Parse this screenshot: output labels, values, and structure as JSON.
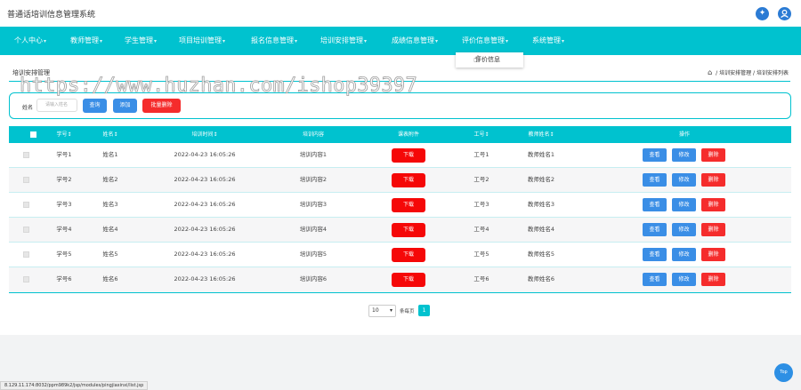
{
  "app": {
    "title": "普通话培训信息管理系统",
    "header_icons": [
      "settings-icon",
      "user-icon"
    ]
  },
  "nav": {
    "items": [
      {
        "label": "个人中心"
      },
      {
        "label": "教师管理"
      },
      {
        "label": "学生管理"
      },
      {
        "label": "项目培训管理"
      },
      {
        "label": "报名信息管理"
      },
      {
        "label": "培训安排管理"
      },
      {
        "label": "成绩信息管理"
      },
      {
        "label": "评价信息管理"
      },
      {
        "label": "系统管理"
      }
    ],
    "open_menu": {
      "parent": "评价信息管理",
      "items": [
        "评价信息"
      ]
    }
  },
  "page": {
    "title": "培训安排管理",
    "breadcrumb": [
      "home-icon",
      "培训安排管理",
      "培训安排列表"
    ],
    "breadcrumb_sep": "/",
    "watermark": "https://www.huzhan.com/ishop39397"
  },
  "search": {
    "label": "姓名",
    "placeholder": "请输入姓名",
    "query_label": "查询",
    "add_label": "添加",
    "batch_delete_label": "批量删除"
  },
  "table": {
    "columns": [
      "学号",
      "姓名",
      "培训时间",
      "培训内容",
      "课表附件",
      "工号",
      "教师姓名",
      "操作"
    ],
    "sortable": [
      true,
      true,
      true,
      false,
      false,
      true,
      true,
      false
    ],
    "download_label": "下载",
    "actions": {
      "view": "查看",
      "edit": "修改",
      "delete": "删除"
    },
    "rows": [
      {
        "xuehao": "学号1",
        "xingming": "姓名1",
        "time": "2022-04-23 16:05:26",
        "content": "培训内容1",
        "gonghao": "工号1",
        "teacher": "教师姓名1"
      },
      {
        "xuehao": "学号2",
        "xingming": "姓名2",
        "time": "2022-04-23 16:05:26",
        "content": "培训内容2",
        "gonghao": "工号2",
        "teacher": "教师姓名2"
      },
      {
        "xuehao": "学号3",
        "xingming": "姓名3",
        "time": "2022-04-23 16:05:26",
        "content": "培训内容3",
        "gonghao": "工号3",
        "teacher": "教师姓名3"
      },
      {
        "xuehao": "学号4",
        "xingming": "姓名4",
        "time": "2022-04-23 16:05:26",
        "content": "培训内容4",
        "gonghao": "工号4",
        "teacher": "教师姓名4"
      },
      {
        "xuehao": "学号5",
        "xingming": "姓名5",
        "time": "2022-04-23 16:05:26",
        "content": "培训内容5",
        "gonghao": "工号5",
        "teacher": "教师姓名5"
      },
      {
        "xuehao": "学号6",
        "xingming": "姓名6",
        "time": "2022-04-23 16:05:26",
        "content": "培训内容6",
        "gonghao": "工号6",
        "teacher": "教师姓名6"
      }
    ]
  },
  "pager": {
    "page_size": "10",
    "per_page_text": "条每页",
    "current_page": "1"
  },
  "top_button": "Top",
  "status_url": "8.129.11.174:8032/ppm989k2/jsp/modules/pingjiaxinxi/list.jsp",
  "colors": {
    "brand": "#00c2cf",
    "primary": "#3a8ee6",
    "danger": "#f52c2c"
  }
}
